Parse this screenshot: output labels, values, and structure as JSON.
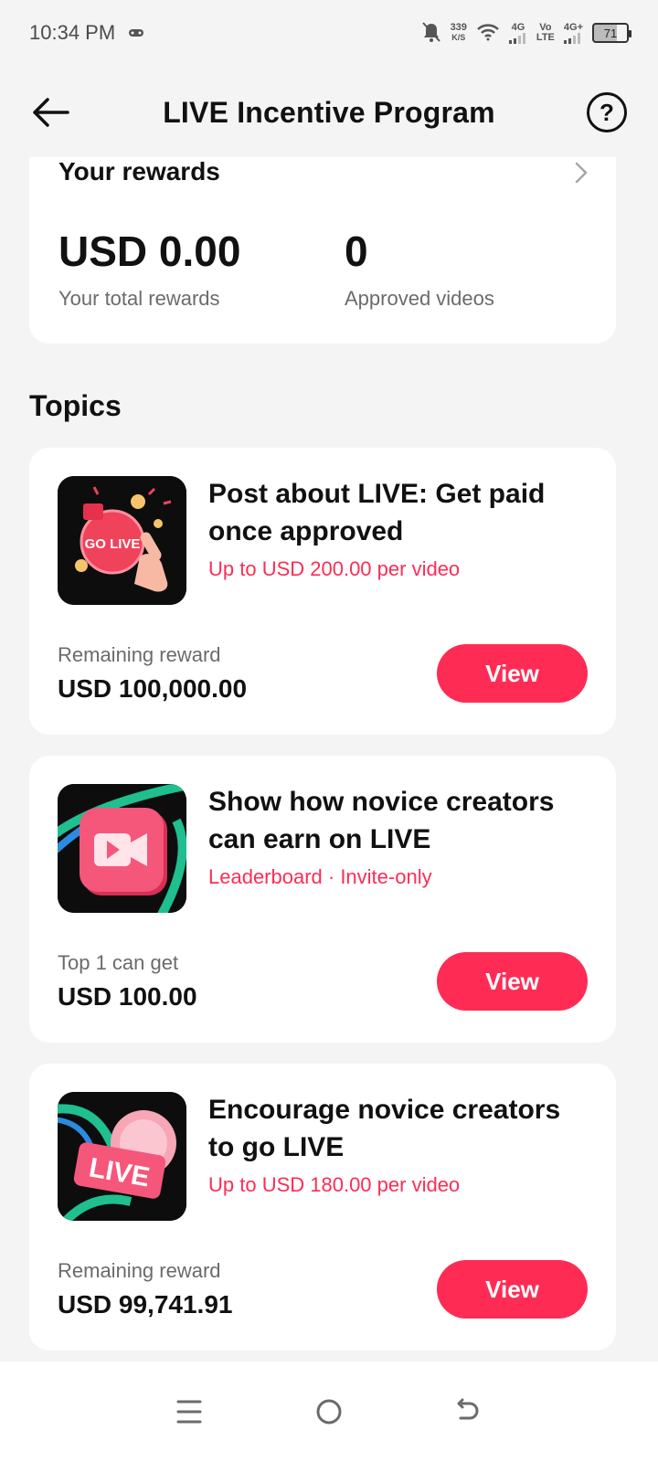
{
  "status": {
    "time": "10:34 PM",
    "speed_value": "339",
    "speed_unit": "K/S",
    "net1": "4G",
    "volte_top": "Vo",
    "volte_bottom": "LTE",
    "net2": "4G+",
    "battery": "71"
  },
  "header": {
    "title": "LIVE Incentive Program"
  },
  "rewards": {
    "title": "Your rewards",
    "total_value": "USD 0.00",
    "total_label": "Your total rewards",
    "videos_value": "0",
    "videos_label": "Approved videos"
  },
  "topics": {
    "heading": "Topics",
    "items": [
      {
        "title": "Post about LIVE: Get paid once approved",
        "subtitle": "Up to USD 200.00 per video",
        "meta_label": "Remaining reward",
        "meta_value": "USD 100,000.00",
        "button": "View",
        "thumb_text": "GO LIVE"
      },
      {
        "title": "Show how novice creators can earn on LIVE",
        "subtitle": "Leaderboard · Invite-only",
        "meta_label": "Top 1 can get",
        "meta_value": "USD 100.00",
        "button": "View"
      },
      {
        "title": "Encourage novice creators to go LIVE",
        "subtitle": "Up to USD 180.00 per video",
        "meta_label": "Remaining reward",
        "meta_value": "USD 99,741.91",
        "button": "View",
        "thumb_text": "LIVE"
      }
    ]
  },
  "colors": {
    "accent": "#fe2c55",
    "background": "#f4f4f5",
    "card": "#ffffff"
  },
  "icons": {
    "back": "arrow-left-icon",
    "help": "question-circle-icon",
    "chevron": "chevron-right-icon",
    "nav_menu": "menu-icon",
    "nav_home": "home-circle-icon",
    "nav_back": "back-gesture-icon"
  }
}
